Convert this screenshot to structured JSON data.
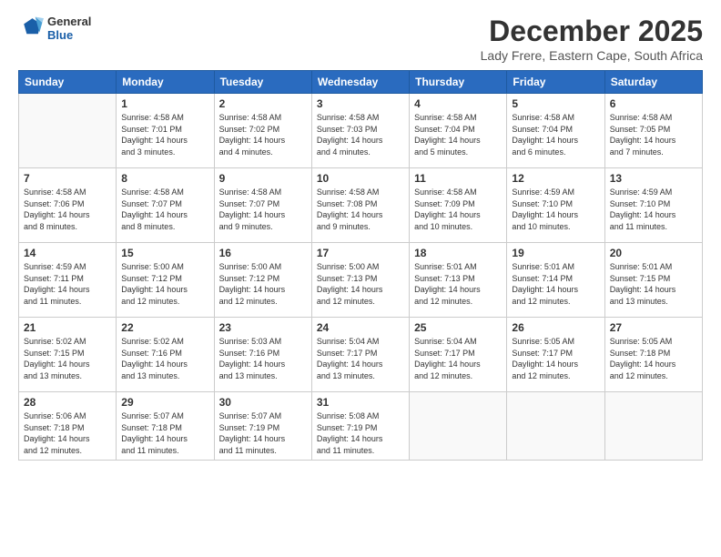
{
  "header": {
    "logo_line1": "General",
    "logo_line2": "Blue",
    "month": "December 2025",
    "location": "Lady Frere, Eastern Cape, South Africa"
  },
  "days_of_week": [
    "Sunday",
    "Monday",
    "Tuesday",
    "Wednesday",
    "Thursday",
    "Friday",
    "Saturday"
  ],
  "weeks": [
    [
      {
        "day": "",
        "info": ""
      },
      {
        "day": "1",
        "info": "Sunrise: 4:58 AM\nSunset: 7:01 PM\nDaylight: 14 hours\nand 3 minutes."
      },
      {
        "day": "2",
        "info": "Sunrise: 4:58 AM\nSunset: 7:02 PM\nDaylight: 14 hours\nand 4 minutes."
      },
      {
        "day": "3",
        "info": "Sunrise: 4:58 AM\nSunset: 7:03 PM\nDaylight: 14 hours\nand 4 minutes."
      },
      {
        "day": "4",
        "info": "Sunrise: 4:58 AM\nSunset: 7:04 PM\nDaylight: 14 hours\nand 5 minutes."
      },
      {
        "day": "5",
        "info": "Sunrise: 4:58 AM\nSunset: 7:04 PM\nDaylight: 14 hours\nand 6 minutes."
      },
      {
        "day": "6",
        "info": "Sunrise: 4:58 AM\nSunset: 7:05 PM\nDaylight: 14 hours\nand 7 minutes."
      }
    ],
    [
      {
        "day": "7",
        "info": "Sunrise: 4:58 AM\nSunset: 7:06 PM\nDaylight: 14 hours\nand 8 minutes."
      },
      {
        "day": "8",
        "info": "Sunrise: 4:58 AM\nSunset: 7:07 PM\nDaylight: 14 hours\nand 8 minutes."
      },
      {
        "day": "9",
        "info": "Sunrise: 4:58 AM\nSunset: 7:07 PM\nDaylight: 14 hours\nand 9 minutes."
      },
      {
        "day": "10",
        "info": "Sunrise: 4:58 AM\nSunset: 7:08 PM\nDaylight: 14 hours\nand 9 minutes."
      },
      {
        "day": "11",
        "info": "Sunrise: 4:58 AM\nSunset: 7:09 PM\nDaylight: 14 hours\nand 10 minutes."
      },
      {
        "day": "12",
        "info": "Sunrise: 4:59 AM\nSunset: 7:10 PM\nDaylight: 14 hours\nand 10 minutes."
      },
      {
        "day": "13",
        "info": "Sunrise: 4:59 AM\nSunset: 7:10 PM\nDaylight: 14 hours\nand 11 minutes."
      }
    ],
    [
      {
        "day": "14",
        "info": "Sunrise: 4:59 AM\nSunset: 7:11 PM\nDaylight: 14 hours\nand 11 minutes."
      },
      {
        "day": "15",
        "info": "Sunrise: 5:00 AM\nSunset: 7:12 PM\nDaylight: 14 hours\nand 12 minutes."
      },
      {
        "day": "16",
        "info": "Sunrise: 5:00 AM\nSunset: 7:12 PM\nDaylight: 14 hours\nand 12 minutes."
      },
      {
        "day": "17",
        "info": "Sunrise: 5:00 AM\nSunset: 7:13 PM\nDaylight: 14 hours\nand 12 minutes."
      },
      {
        "day": "18",
        "info": "Sunrise: 5:01 AM\nSunset: 7:13 PM\nDaylight: 14 hours\nand 12 minutes."
      },
      {
        "day": "19",
        "info": "Sunrise: 5:01 AM\nSunset: 7:14 PM\nDaylight: 14 hours\nand 12 minutes."
      },
      {
        "day": "20",
        "info": "Sunrise: 5:01 AM\nSunset: 7:15 PM\nDaylight: 14 hours\nand 13 minutes."
      }
    ],
    [
      {
        "day": "21",
        "info": "Sunrise: 5:02 AM\nSunset: 7:15 PM\nDaylight: 14 hours\nand 13 minutes."
      },
      {
        "day": "22",
        "info": "Sunrise: 5:02 AM\nSunset: 7:16 PM\nDaylight: 14 hours\nand 13 minutes."
      },
      {
        "day": "23",
        "info": "Sunrise: 5:03 AM\nSunset: 7:16 PM\nDaylight: 14 hours\nand 13 minutes."
      },
      {
        "day": "24",
        "info": "Sunrise: 5:04 AM\nSunset: 7:17 PM\nDaylight: 14 hours\nand 13 minutes."
      },
      {
        "day": "25",
        "info": "Sunrise: 5:04 AM\nSunset: 7:17 PM\nDaylight: 14 hours\nand 12 minutes."
      },
      {
        "day": "26",
        "info": "Sunrise: 5:05 AM\nSunset: 7:17 PM\nDaylight: 14 hours\nand 12 minutes."
      },
      {
        "day": "27",
        "info": "Sunrise: 5:05 AM\nSunset: 7:18 PM\nDaylight: 14 hours\nand 12 minutes."
      }
    ],
    [
      {
        "day": "28",
        "info": "Sunrise: 5:06 AM\nSunset: 7:18 PM\nDaylight: 14 hours\nand 12 minutes."
      },
      {
        "day": "29",
        "info": "Sunrise: 5:07 AM\nSunset: 7:18 PM\nDaylight: 14 hours\nand 11 minutes."
      },
      {
        "day": "30",
        "info": "Sunrise: 5:07 AM\nSunset: 7:19 PM\nDaylight: 14 hours\nand 11 minutes."
      },
      {
        "day": "31",
        "info": "Sunrise: 5:08 AM\nSunset: 7:19 PM\nDaylight: 14 hours\nand 11 minutes."
      },
      {
        "day": "",
        "info": ""
      },
      {
        "day": "",
        "info": ""
      },
      {
        "day": "",
        "info": ""
      }
    ]
  ]
}
